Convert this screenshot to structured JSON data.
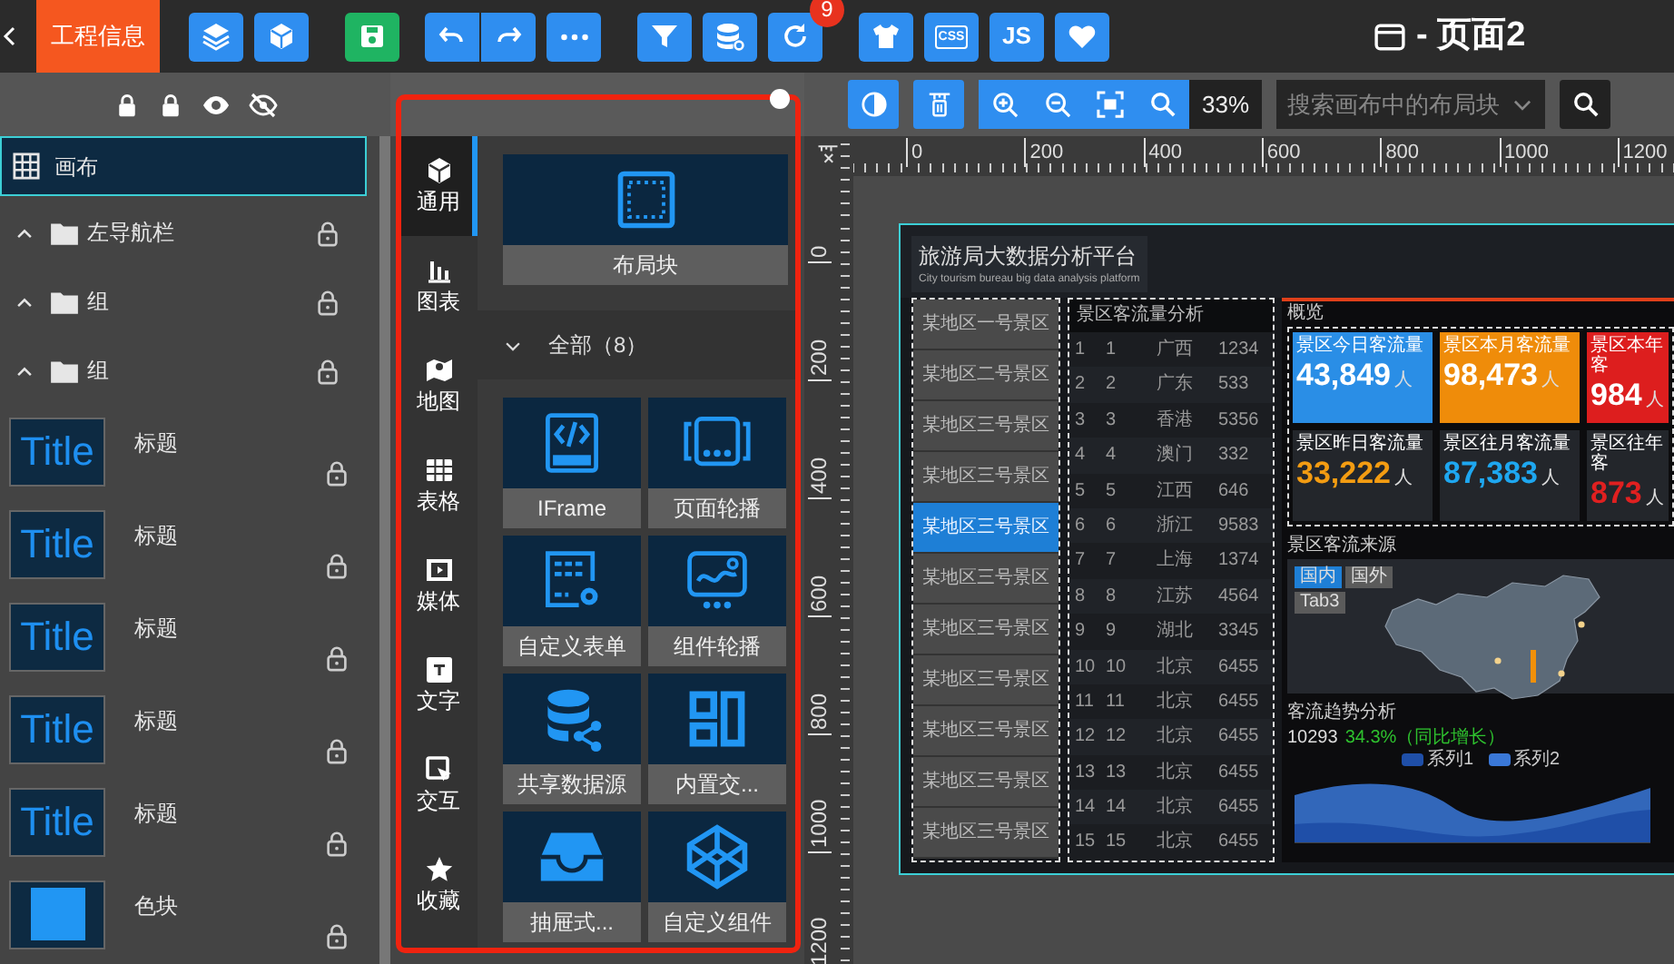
{
  "top_bar": {
    "project_tab": "工程信息",
    "refresh_badge": "9",
    "css_label": "CSS",
    "js_label": "JS",
    "page_title": "- 页面2"
  },
  "layer_panel": {
    "items": [
      {
        "kind": "canvas",
        "label": "画布",
        "selected": true
      },
      {
        "kind": "group",
        "label": "左导航栏",
        "selected": false,
        "expanded": false
      },
      {
        "kind": "group",
        "label": "组",
        "selected": false,
        "expanded": false
      },
      {
        "kind": "group",
        "label": "组",
        "selected": false,
        "expanded": false
      },
      {
        "kind": "title",
        "label": "标题",
        "thumb": "Title",
        "selected": false
      },
      {
        "kind": "title",
        "label": "标题",
        "thumb": "Title",
        "selected": false
      },
      {
        "kind": "title",
        "label": "标题",
        "thumb": "Title",
        "selected": false
      },
      {
        "kind": "title",
        "label": "标题",
        "thumb": "Title",
        "selected": false
      },
      {
        "kind": "title",
        "label": "标题",
        "thumb": "Title",
        "selected": false
      },
      {
        "kind": "color_block",
        "label": "色块",
        "selected": false
      }
    ]
  },
  "component_panel": {
    "categories": [
      {
        "kind": "general",
        "label": "通用",
        "selected": true
      },
      {
        "kind": "chart",
        "label": "图表",
        "selected": false
      },
      {
        "kind": "map",
        "label": "地图",
        "selected": false
      },
      {
        "kind": "table",
        "label": "表格",
        "selected": false
      },
      {
        "kind": "media",
        "label": "媒体",
        "selected": false
      },
      {
        "kind": "text",
        "label": "文字",
        "selected": false
      },
      {
        "kind": "interaction",
        "label": "交互",
        "selected": false
      },
      {
        "kind": "favorite",
        "label": "收藏",
        "selected": false
      }
    ],
    "layout_block": "布局块",
    "section": {
      "label": "全部（8）",
      "expanded": true
    },
    "components": [
      {
        "kind": "iframe",
        "label": "IFrame"
      },
      {
        "kind": "page_carousel",
        "label": "页面轮播"
      },
      {
        "kind": "form",
        "label": "自定义表单"
      },
      {
        "kind": "widget_carousel",
        "label": "组件轮播"
      },
      {
        "kind": "shared_data",
        "label": "共享数据源"
      },
      {
        "kind": "builtin",
        "label": "内置交..."
      },
      {
        "kind": "drawer",
        "label": "抽屉式..."
      },
      {
        "kind": "custom",
        "label": "自定义组件"
      }
    ]
  },
  "canvas_toolbar": {
    "zoom": "33%",
    "search": {
      "placeholder": "搜索画布中的布局块"
    }
  },
  "rulers": {
    "horizontal": [
      "0",
      "200",
      "400",
      "600",
      "800",
      "1000",
      "1200"
    ],
    "vertical": [
      "0",
      "200",
      "400",
      "600",
      "800",
      "1000",
      "1200"
    ]
  },
  "preview": {
    "title": "旅游局大数据分析平台",
    "subtitle": "City tourism bureau big data analysis platform",
    "spots": [
      {
        "label": "某地区一号景区",
        "selected": false
      },
      {
        "label": "某地区二号景区",
        "selected": false
      },
      {
        "label": "某地区三号景区",
        "selected": false
      },
      {
        "label": "某地区三号景区",
        "selected": false
      },
      {
        "label": "某地区三号景区",
        "selected": true
      },
      {
        "label": "某地区三号景区",
        "selected": false
      },
      {
        "label": "某地区三号景区",
        "selected": false
      },
      {
        "label": "某地区三号景区",
        "selected": false
      },
      {
        "label": "某地区三号景区",
        "selected": false
      },
      {
        "label": "某地区三号景区",
        "selected": false
      },
      {
        "label": "某地区三号景区",
        "selected": false
      }
    ],
    "flow_table": {
      "title": "景区客流量分析",
      "rows": [
        [
          "1",
          "1",
          "广西",
          "1234"
        ],
        [
          "2",
          "2",
          "广东",
          "533"
        ],
        [
          "3",
          "3",
          "香港",
          "5356"
        ],
        [
          "4",
          "4",
          "澳门",
          "332"
        ],
        [
          "5",
          "5",
          "江西",
          "646"
        ],
        [
          "6",
          "6",
          "浙江",
          "9583"
        ],
        [
          "7",
          "7",
          "上海",
          "1374"
        ],
        [
          "8",
          "8",
          "江苏",
          "4564"
        ],
        [
          "9",
          "9",
          "湖北",
          "3345"
        ],
        [
          "10",
          "10",
          "北京",
          "6455"
        ],
        [
          "11",
          "11",
          "北京",
          "6455"
        ],
        [
          "12",
          "12",
          "北京",
          "6455"
        ],
        [
          "13",
          "13",
          "北京",
          "6455"
        ],
        [
          "14",
          "14",
          "北京",
          "6455"
        ],
        [
          "15",
          "15",
          "北京",
          "6455"
        ]
      ]
    },
    "overview": {
      "title": "概览",
      "cards": [
        {
          "label": "景区今日客流量",
          "value": "43,849",
          "unit": "人",
          "filled": true,
          "color": "#2a8ee6"
        },
        {
          "label": "景区本月客流量",
          "value": "98,473",
          "unit": "人",
          "filled": true,
          "color": "#ef8c0a"
        },
        {
          "label": "景区本年客",
          "value": "984",
          "unit": "人",
          "filled": true,
          "color": "#dd1e1e"
        },
        {
          "label": "景区昨日客流量",
          "value": "33,222",
          "unit": "人",
          "filled": false,
          "color": "#f39c12"
        },
        {
          "label": "景区往月客流量",
          "value": "87,383",
          "unit": "人",
          "filled": false,
          "color": "#1ea7f0"
        },
        {
          "label": "景区往年客",
          "value": "873",
          "unit": "人",
          "filled": false,
          "color": "#e02020"
        }
      ]
    },
    "source_map": {
      "title": "景区客流来源",
      "tabs": [
        {
          "label": "国内",
          "selected": true
        },
        {
          "label": "国外",
          "selected": false
        },
        {
          "label": "Tab3",
          "selected": false
        }
      ]
    },
    "trend": {
      "title": "客流趋势分析",
      "total": "10293",
      "change": "34.3%（同比增长）",
      "legend": [
        {
          "name": "系列1",
          "color": "#1f4fa8"
        },
        {
          "name": "系列2",
          "color": "#3a78d8"
        }
      ]
    }
  }
}
